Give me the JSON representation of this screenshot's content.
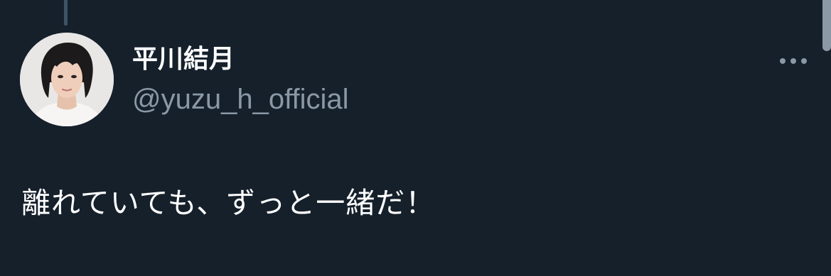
{
  "tweet": {
    "author": {
      "display_name": "平川結月",
      "handle": "@yuzu_h_official",
      "avatar_icon": "profile-photo"
    },
    "text": "離れていても、ずっと一緒だ！",
    "more_icon": "more-horizontal-icon"
  },
  "colors": {
    "background": "#15202b",
    "primary_text": "#ffffff",
    "secondary_text": "#8b98a5",
    "thread_line": "#3d5466"
  }
}
